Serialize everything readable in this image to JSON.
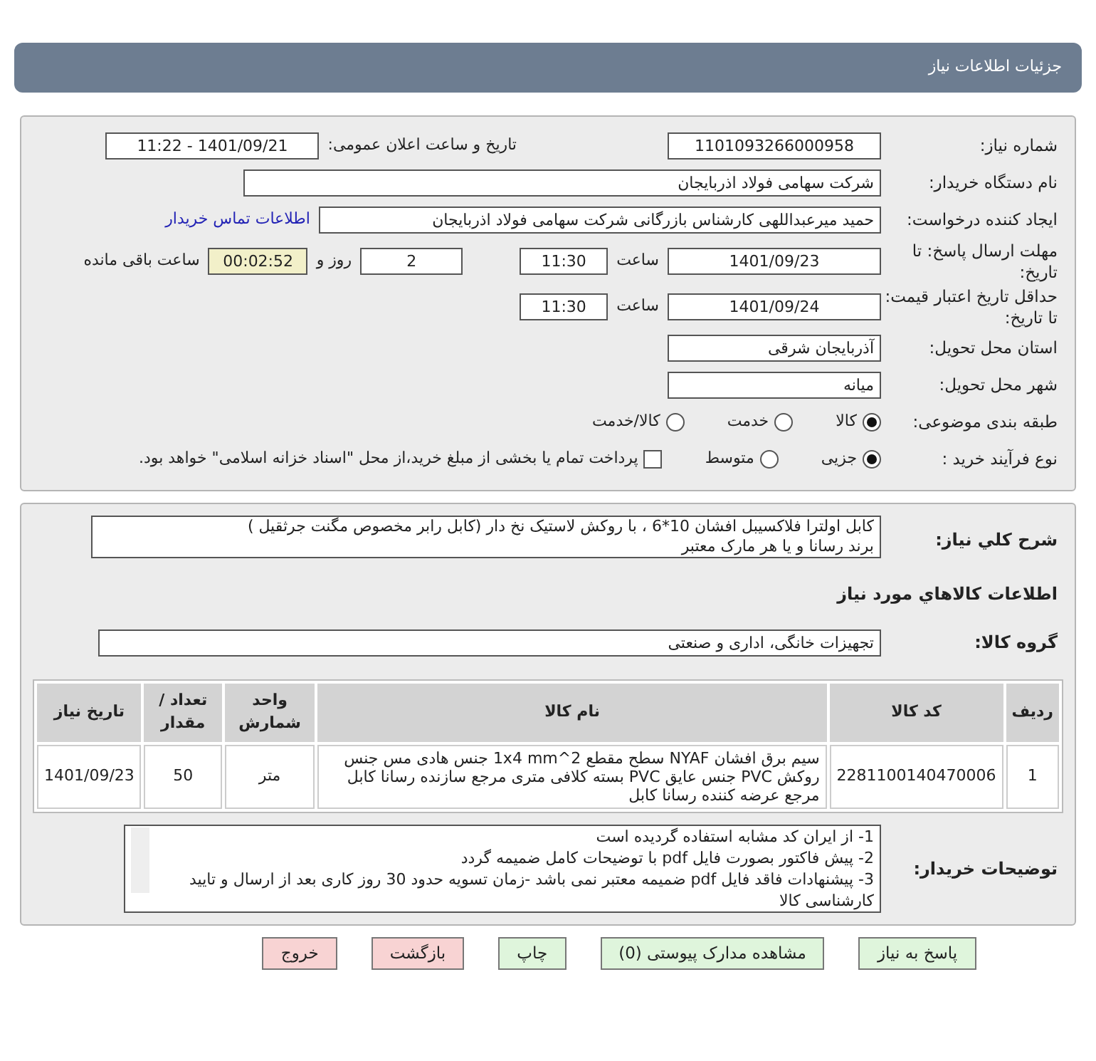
{
  "header": {
    "title": "جزئیات اطلاعات نیاز"
  },
  "need_number": {
    "label": "شماره نیاز:",
    "value": "1101093266000958"
  },
  "announce": {
    "label": "تاریخ و ساعت اعلان عمومی:",
    "value": "1401/09/21 - 11:22"
  },
  "buyer": {
    "label": "نام دستگاه خریدار:",
    "value": "شرکت سهامی فولاد اذربایجان"
  },
  "requester": {
    "label": "ایجاد کننده درخواست:",
    "value": "حمید میرعبداللهی کارشناس بازرگانی شرکت سهامی فولاد اذربایجان",
    "link": "اطلاعات تماس خریدار"
  },
  "deadline": {
    "label": "مهلت ارسال پاسخ: تا تاریخ:",
    "date": "1401/09/23",
    "time_label": "ساعت",
    "time": "11:30",
    "days": "2",
    "days_label": "روز و",
    "remaining": "00:02:52",
    "remaining_label": "ساعت باقی مانده"
  },
  "validity": {
    "label": "حداقل تاریخ اعتبار قیمت: تا تاریخ:",
    "date": "1401/09/24",
    "time_label": "ساعت",
    "time": "11:30"
  },
  "province": {
    "label": "استان محل تحویل:",
    "value": "آذربایجان شرقی"
  },
  "city": {
    "label": "شهر محل تحویل:",
    "value": "میانه"
  },
  "category": {
    "label": "طبقه بندی موضوعی:",
    "options": [
      {
        "label": "کالا",
        "selected": true
      },
      {
        "label": "خدمت",
        "selected": false
      },
      {
        "label": "کالا/خدمت",
        "selected": false
      }
    ]
  },
  "process": {
    "label": "نوع فرآیند خرید :",
    "options": [
      {
        "label": "جزیی",
        "selected": true
      },
      {
        "label": "متوسط",
        "selected": false
      }
    ],
    "payment": {
      "label": "پرداخت تمام یا بخشی از مبلغ خرید،از محل \"اسناد خزانه اسلامی\" خواهد بود.",
      "checked": false
    }
  },
  "description": {
    "label": "شرح کلي نياز:",
    "lines": [
      "کابل اولترا فلاکسیبل افشان 10*6 ، با روکش لاستیک نخ دار (کابل رابر مخصوص مگنت جرثقیل )",
      "برند رسانا و یا هر مارک معتبر"
    ]
  },
  "goods_heading": "اطلاعات کالاهاي مورد نياز",
  "goods_group": {
    "label": "گروه کالا:",
    "value": "تجهیزات خانگی، اداری و صنعتی"
  },
  "table": {
    "columns": [
      "ردیف",
      "کد کالا",
      "نام کالا",
      "واحد شمارش",
      "تعداد / مقدار",
      "تاریخ نیاز"
    ],
    "rows": [
      [
        "1",
        "2281100140470006",
        "سیم برق افشان NYAF سطح مقطع 2^1x4 mm جنس هادی مس جنس روکش PVC جنس عایق PVC بسته کلافی متری مرجع سازنده رسانا کابل مرجع عرضه کننده رسانا کابل",
        "متر",
        "50",
        "1401/09/23"
      ]
    ]
  },
  "notes": {
    "label": "توضیحات خریدار:",
    "lines": [
      "1- از ایران کد مشابه استفاده گردیده است",
      "2- پیش فاکتور بصورت فایل pdf با توضیحات کامل ضمیمه گردد",
      "3- پیشنهادات فاقد فایل pdf  ضمیمه معتبر نمی باشد -زمان تسویه حدود 30 روز کاری بعد از ارسال و تایید کارشناسی کالا"
    ]
  },
  "buttons": [
    {
      "label": "پاسخ به نیاز",
      "kind": "go"
    },
    {
      "label": "مشاهده مدارک پیوستی (0)",
      "kind": "go"
    },
    {
      "label": "چاپ",
      "kind": "go"
    },
    {
      "label": "بازگشت",
      "kind": "stop"
    },
    {
      "label": "خروج",
      "kind": "stop"
    }
  ]
}
